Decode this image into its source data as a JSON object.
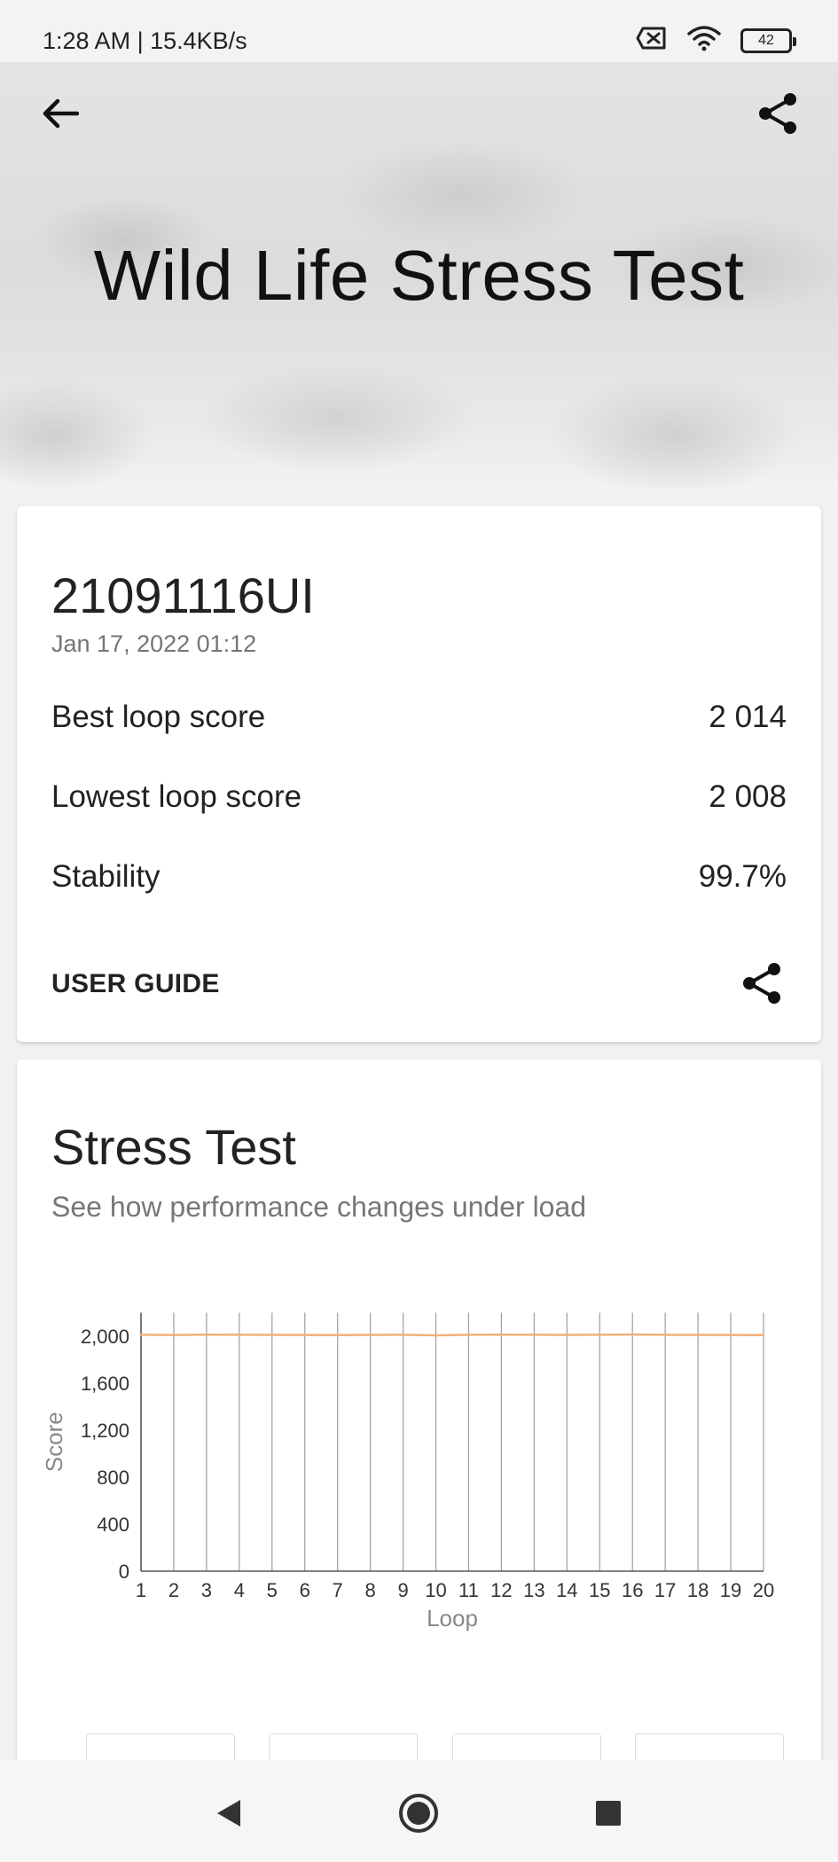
{
  "status_bar": {
    "time_speed": "1:28 AM | 15.4KB/s",
    "battery": "42"
  },
  "hero": {
    "title": "Wild Life Stress Test"
  },
  "result_card": {
    "device": "21091116UI",
    "date": "Jan 17, 2022 01:12",
    "best_label": "Best loop score",
    "best_value": "2 014",
    "lowest_label": "Lowest loop score",
    "lowest_value": "2 008",
    "stability_label": "Stability",
    "stability_value": "99.7%",
    "user_guide": "USER GUIDE"
  },
  "stress_card": {
    "title": "Stress Test",
    "subtitle": "See how performance changes under load"
  },
  "colors": {
    "line": "#f0b07a",
    "grid": "#9e9e9e"
  },
  "chart_data": {
    "type": "line",
    "xlabel": "Loop",
    "ylabel": "Score",
    "ylim": [
      0,
      2200
    ],
    "yticks": [
      0,
      400,
      800,
      1200,
      1600,
      2000
    ],
    "ytick_labels": [
      "0",
      "400",
      "800",
      "1,200",
      "1,600",
      "2,000"
    ],
    "x": [
      1,
      2,
      3,
      4,
      5,
      6,
      7,
      8,
      9,
      10,
      11,
      12,
      13,
      14,
      15,
      16,
      17,
      18,
      19,
      20
    ],
    "x_labels": [
      "1",
      "2",
      "3",
      "4",
      "5",
      "6",
      "7",
      "8",
      "9",
      "10",
      "11",
      "12",
      "13",
      "14",
      "15",
      "16",
      "17",
      "18",
      "19",
      "20"
    ],
    "series": [
      {
        "values": [
          2012,
          2010,
          2013,
          2012,
          2011,
          2010,
          2009,
          2011,
          2012,
          2008,
          2012,
          2013,
          2012,
          2011,
          2012,
          2014,
          2012,
          2011,
          2010,
          2009
        ]
      }
    ],
    "grid": "vertical"
  }
}
